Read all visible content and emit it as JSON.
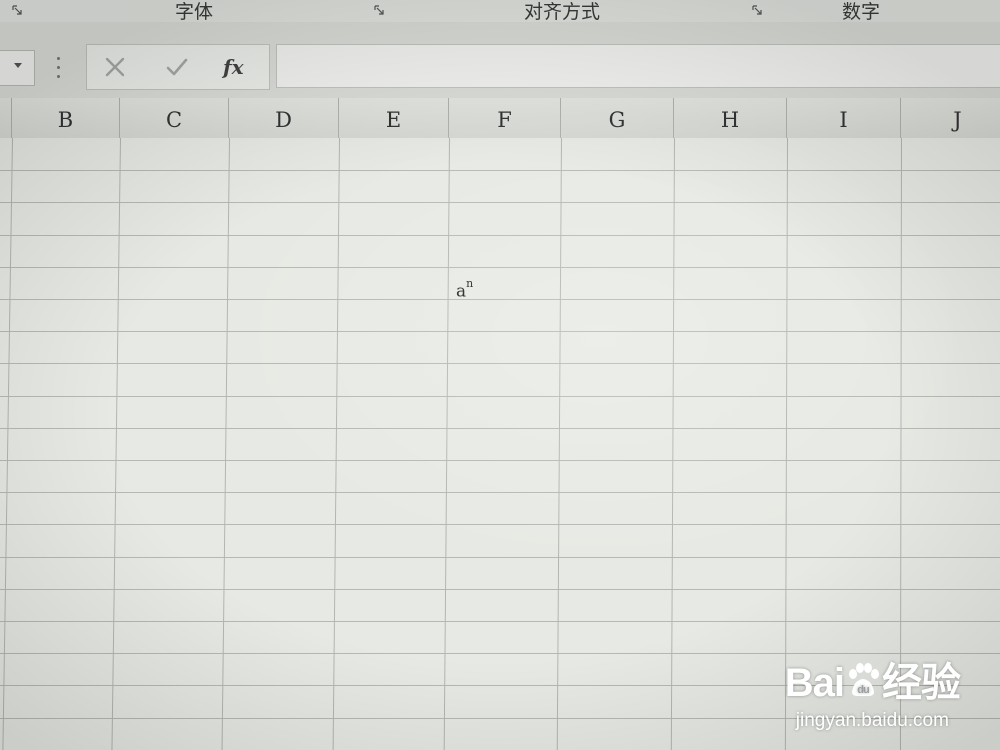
{
  "ribbon": {
    "groups": [
      {
        "label": "字体"
      },
      {
        "label": "对齐方式"
      },
      {
        "label": "数字"
      }
    ]
  },
  "formula_bar": {
    "cancel_icon": "x-icon",
    "enter_icon": "check-icon",
    "function_label": "fx",
    "value": ""
  },
  "columns": [
    "B",
    "C",
    "D",
    "E",
    "F",
    "G",
    "H",
    "I",
    "J"
  ],
  "cells": [
    {
      "base": "a",
      "superscript": "n"
    }
  ],
  "watermark": {
    "brand": "Bai",
    "brand_suffix": "经验",
    "url": "jingyan.baidu.com"
  }
}
